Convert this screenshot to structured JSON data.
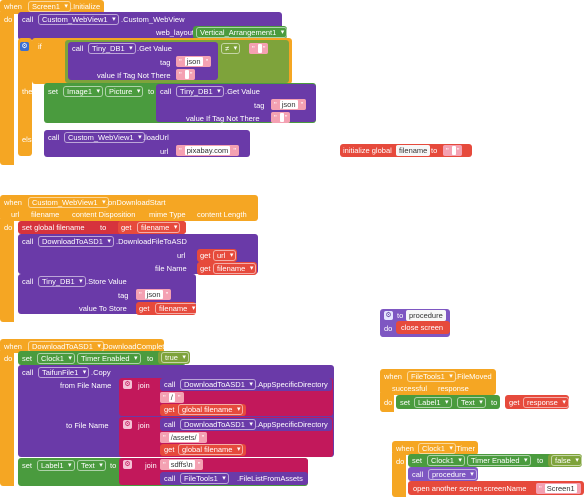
{
  "initialize": {
    "when": "when",
    "component": "Screen1",
    "event": ".Initialize",
    "do": "do",
    "call": "call",
    "webview_component": "Custom_WebView1",
    "webview_method": ".Custom_WebView",
    "web_layout_label": "web_layout",
    "web_layout_value": "Vertical_Arrangement1",
    "if_label": "if",
    "then_label": "then",
    "else_label": "else",
    "neq": "≠",
    "tinydb": "Tiny_DB1",
    "get_value": ".Get Value",
    "tag_label": "tag",
    "tag_value": "json",
    "value_if_label": "value If Tag Not There",
    "set_label": "set",
    "image_component": "Image1",
    "picture_prop": "Picture",
    "to_label": "to",
    "load_url": ".loadUrl",
    "url_label": "url",
    "url_value": "pixabay.com"
  },
  "global_init": {
    "label": "initialize global",
    "name": "filename",
    "to": "to"
  },
  "download_start": {
    "when": "when",
    "component": "Custom_WebView1",
    "event": ".onDownloadStart",
    "params": [
      "url",
      "filename",
      "content Disposition",
      "mime Type",
      "content Length"
    ],
    "do": "do",
    "set_global": "set global filename",
    "to": "to",
    "get": "get",
    "get_filename": "filename",
    "call": "call",
    "dl_component": "DownloadToASD1",
    "dl_method": ".DownloadFileToASD",
    "url_label": "url",
    "get_url": "url",
    "file_name_label": "file Name",
    "tinydb": "Tiny_DB1",
    "store_value": ".Store Value",
    "tag_label": "tag",
    "tag_value": "json",
    "value_to_store_label": "value To Store"
  },
  "procedure": {
    "to": "to",
    "name": "procedure",
    "do": "do",
    "body": "close screen"
  },
  "download_completed": {
    "when": "when",
    "component": "DownloadToASD1",
    "event": ".DownloadCompleted",
    "do": "do",
    "set": "set",
    "clock": "Clock1",
    "timer_enabled": "Timer Enabled",
    "to": "to",
    "true_value": "true",
    "call": "call",
    "taifun": "TaifunFile1",
    "copy": ".Copy",
    "from_label": "from File Name",
    "to_file_label": "to File Name",
    "join": "join",
    "asd_component": "DownloadToASD1",
    "asd_method": ".AppSpecificDirectory",
    "slash": "/",
    "assets": "/assets/",
    "get": "get",
    "global_filename": "global filename",
    "label_component": "Label1",
    "text_prop": "Text",
    "sdffs": "sdffs\\n",
    "filetools": "FileTools1",
    "file_list": ".FileListFromAssets"
  },
  "file_moved": {
    "when": "when",
    "component": "FileTools1",
    "event": ".FileMoved",
    "params": [
      "successful",
      "response"
    ],
    "do": "do",
    "set": "set",
    "label_component": "Label1",
    "text_prop": "Text",
    "to": "to",
    "get": "get",
    "get_response": "response"
  },
  "timer": {
    "when": "when",
    "component": "Clock1",
    "event": ".Timer",
    "do": "do",
    "set": "set",
    "clock": "Clock1",
    "timer_enabled": "Timer Enabled",
    "to": "to",
    "false_value": "false",
    "call": "call",
    "procedure": "procedure",
    "open_screen": "open another screen  screenName",
    "screen_value": "Screen1"
  }
}
